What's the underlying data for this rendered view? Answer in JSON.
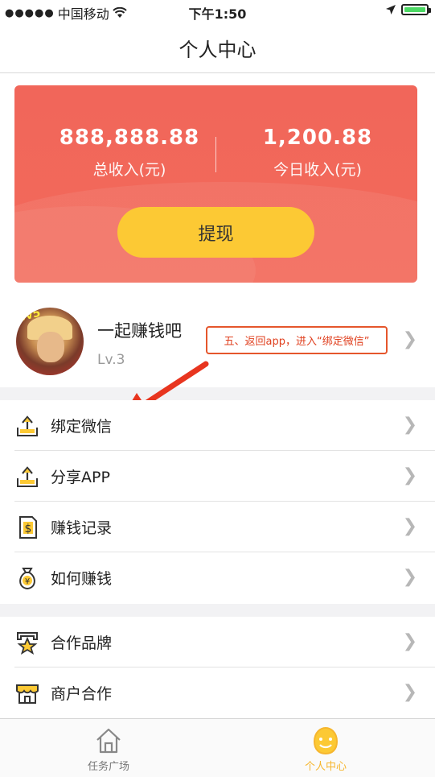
{
  "status_bar": {
    "carrier": "中国移动",
    "time": "下午1:50"
  },
  "header": {
    "title": "个人中心"
  },
  "income_card": {
    "total_income_value": "888,888.88",
    "total_income_label": "总收入(元)",
    "today_income_value": "1,200.88",
    "today_income_label": "今日收入(元)",
    "withdraw_label": "提现",
    "card_color": "#f1665a",
    "button_color": "#fcc934"
  },
  "profile": {
    "nickname": "一起赚钱吧",
    "level": "Lv.3",
    "avatar_badge": "5v5"
  },
  "annotation": {
    "text": "五、返回app，进入“绑定微信”",
    "color": "#e5562c"
  },
  "menu_group1": [
    {
      "label": "绑定微信",
      "icon": "upload-tray-icon"
    },
    {
      "label": "分享APP",
      "icon": "upload-tray-icon"
    },
    {
      "label": "赚钱记录",
      "icon": "dollar-document-icon"
    },
    {
      "label": "如何赚钱",
      "icon": "money-bag-icon"
    }
  ],
  "menu_group2": [
    {
      "label": "合作品牌",
      "icon": "star-badge-icon"
    },
    {
      "label": "商户合作",
      "icon": "storefront-icon"
    }
  ],
  "tab_bar": {
    "tabs": [
      {
        "label": "任务广场",
        "icon": "house-icon",
        "active": false
      },
      {
        "label": "个人中心",
        "icon": "smiley-face-icon",
        "active": true
      }
    ],
    "active_color": "#f6b62e"
  }
}
